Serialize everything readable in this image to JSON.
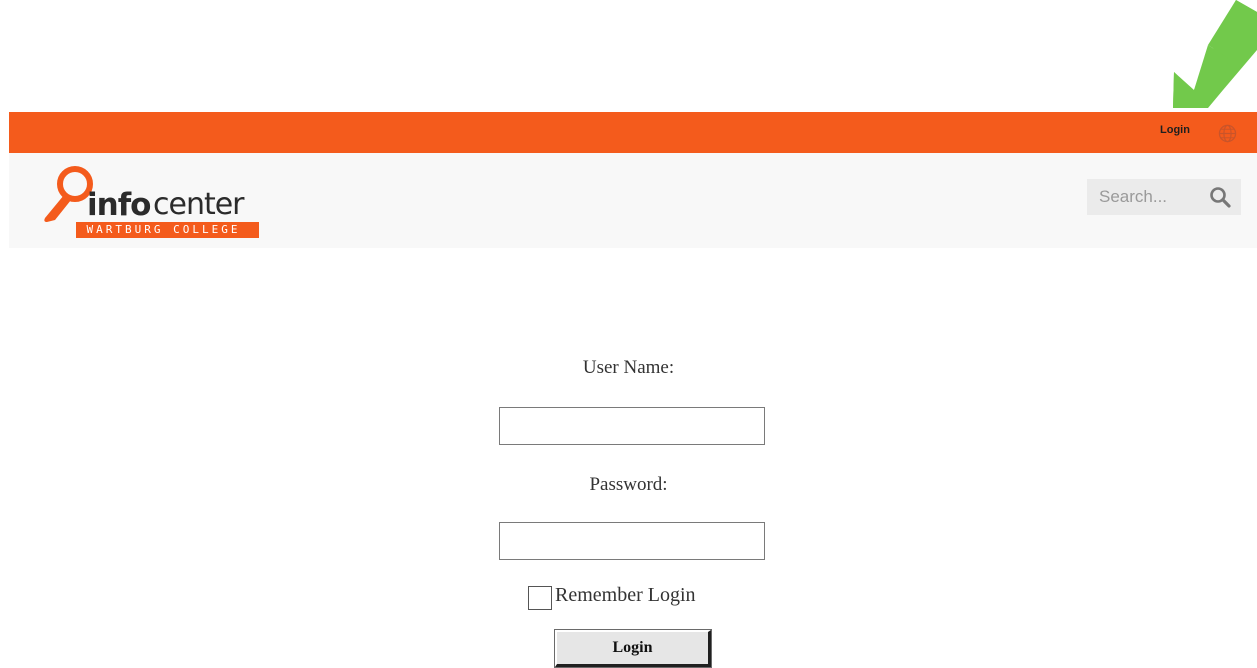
{
  "topbar": {
    "login_link": "Login",
    "globe_icon": "globe-icon",
    "background_color": "#f45b1c"
  },
  "annotation": {
    "arrow_icon": "green-arrow-icon",
    "color": "#72c94b"
  },
  "header": {
    "logo": {
      "word_bold": "info",
      "word_light": "center",
      "subtitle": "WARTBURG COLLEGE",
      "icon": "magnifier-logo-icon"
    },
    "search": {
      "placeholder": "Search...",
      "icon": "search-icon"
    }
  },
  "form": {
    "username_label": "User Name:",
    "username_value": "",
    "password_label": "Password:",
    "password_value": "",
    "remember_label": "Remember Login",
    "remember_checked": false,
    "submit_label": "Login"
  },
  "colors": {
    "brand_orange": "#f45b1c",
    "header_bg": "#f8f8f8",
    "text_dark": "#333333"
  }
}
